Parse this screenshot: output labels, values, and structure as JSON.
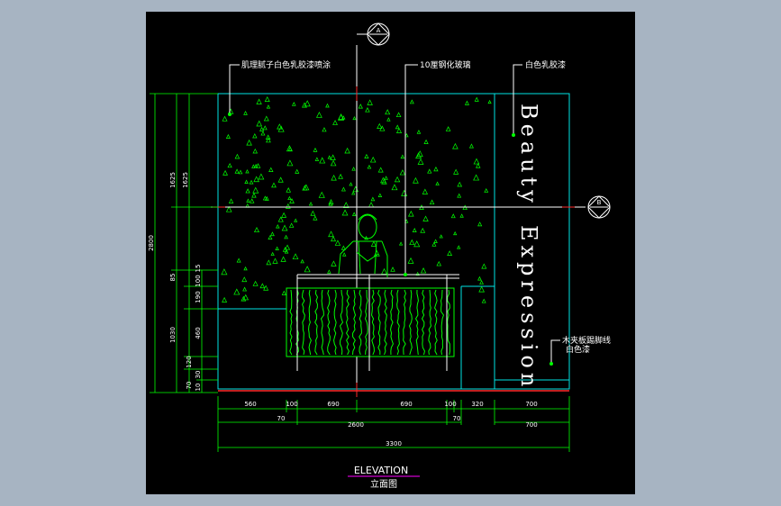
{
  "drawing": {
    "title": "ELEVATION",
    "subtitle": "立面图",
    "section_a": "A",
    "section_b": "B",
    "callouts": {
      "wall_finish": "肌理腻子白色乳胶漆喷涂",
      "glass": "10厘钢化玻璃",
      "white_paint": "白色乳胶漆",
      "skirting_line1": "木夹板踢脚线",
      "skirting_line2": "白色漆"
    },
    "signage": {
      "word1": "Beauty",
      "word2": "Expression"
    },
    "dimensions": {
      "left_outer": "2800",
      "left_upper": "1625",
      "left_upper2": "1625",
      "left_85": "85",
      "left_15": "15",
      "left_100": "100",
      "left_190": "190",
      "left_1030": "1030",
      "left_460": "460",
      "left_120": "120",
      "left_30": "30",
      "left_70": "70",
      "left_10": "10",
      "b_560": "560",
      "b_100a": "100",
      "b_690a": "690",
      "b_690b": "690",
      "b_100b": "100",
      "b_320": "320",
      "b_700": "700",
      "b_70a": "70",
      "b_70b": "70",
      "b_700b": "700",
      "b_2600": "2600",
      "b_3300": "3300"
    },
    "colors": {
      "background": "#000000",
      "frame": "#00e5e5",
      "stipple": "#00ff00",
      "dimension": "#00ff00",
      "text": "#ffffff",
      "accent": "#ff0000",
      "title_underline": "#ff00ff"
    }
  }
}
